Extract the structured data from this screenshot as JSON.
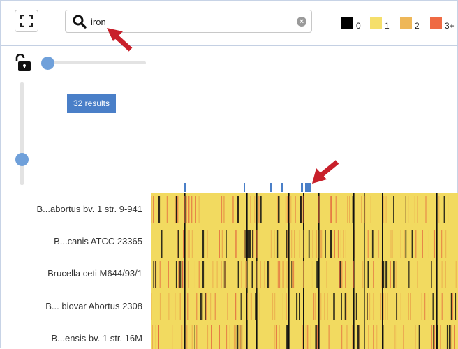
{
  "search": {
    "value": "iron",
    "placeholder": "",
    "clear_glyph": "×"
  },
  "legend": [
    {
      "label": "0",
      "color": "#000000"
    },
    {
      "label": "1",
      "color": "#f5df6b"
    },
    {
      "label": "2",
      "color": "#eeb758"
    },
    {
      "label": "3+",
      "color": "#ef6a43"
    }
  ],
  "results_badge": "32 results",
  "sliders": {
    "horizontal_value": 0,
    "vertical_value": 0.32
  },
  "rows": [
    {
      "label": "B...abortus bv. 1 str. 9-941"
    },
    {
      "label": "B...canis ATCC 23365"
    },
    {
      "label": "Brucella ceti M644/93/1"
    },
    {
      "label": "B... biovar Abortus 2308"
    },
    {
      "label": "B...ensis bv. 1 str. 16M"
    }
  ],
  "colors": {
    "base": "#f2da60",
    "black": "#111111",
    "orange": "#e8a24a",
    "red": "#e2603c",
    "marker": "#4a7fc8",
    "annotation_arrow": "#c8202b"
  },
  "icons": {
    "expand": "expand-icon",
    "lock": "unlock-icon",
    "search": "search-icon",
    "clear": "clear-icon"
  }
}
